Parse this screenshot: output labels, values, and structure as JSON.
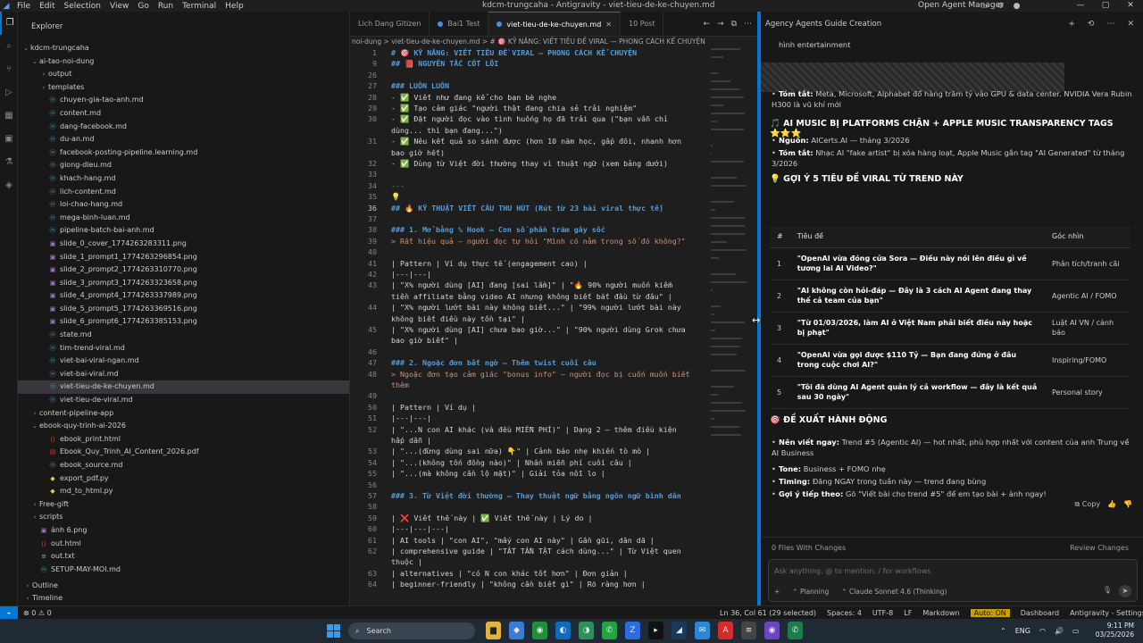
{
  "menubar": {
    "items": [
      "File",
      "Edit",
      "Selection",
      "View",
      "Go",
      "Run",
      "Terminal",
      "Help"
    ],
    "window_title": "kdcm-trungcaha - Antigravity - viet-tieu-de-ke-chuyen.md",
    "agent_manager": "Open Agent Manager"
  },
  "explorer": {
    "title": "Explorer",
    "root": "kdcm-trungcaha",
    "tree": [
      {
        "label": "ai-tao-noi-dung",
        "type": "folder-open",
        "indent": 1
      },
      {
        "label": "output",
        "type": "folder",
        "indent": 2
      },
      {
        "label": "templates",
        "type": "folder",
        "indent": 2
      },
      {
        "label": "chuyen-gia-tao-anh.md",
        "type": "md",
        "indent": 2
      },
      {
        "label": "content.md",
        "type": "md",
        "indent": 2
      },
      {
        "label": "dang-facebook.md",
        "type": "md",
        "indent": 2
      },
      {
        "label": "du-an.md",
        "type": "md",
        "indent": 2
      },
      {
        "label": "facebook-posting-pipeline.learning.md",
        "type": "md",
        "indent": 2
      },
      {
        "label": "giong-dieu.md",
        "type": "md",
        "indent": 2
      },
      {
        "label": "khach-hang.md",
        "type": "md",
        "indent": 2
      },
      {
        "label": "lich-content.md",
        "type": "md",
        "indent": 2
      },
      {
        "label": "loi-chao-hang.md",
        "type": "md",
        "indent": 2
      },
      {
        "label": "mega-binh-luan.md",
        "type": "md",
        "indent": 2
      },
      {
        "label": "pipeline-batch-bai-anh.md",
        "type": "md",
        "indent": 2
      },
      {
        "label": "slide_0_cover_1774263283311.png",
        "type": "png",
        "indent": 2
      },
      {
        "label": "slide_1_prompt1_1774263296854.png",
        "type": "png",
        "indent": 2
      },
      {
        "label": "slide_2_prompt2_1774263310770.png",
        "type": "png",
        "indent": 2
      },
      {
        "label": "slide_3_prompt3_1774263323658.png",
        "type": "png",
        "indent": 2
      },
      {
        "label": "slide_4_prompt4_1774263337989.png",
        "type": "png",
        "indent": 2
      },
      {
        "label": "slide_5_prompt5_1774263369516.png",
        "type": "png",
        "indent": 2
      },
      {
        "label": "slide_6_prompt6_1774263385153.png",
        "type": "png",
        "indent": 2
      },
      {
        "label": "state.md",
        "type": "md",
        "indent": 2
      },
      {
        "label": "tim-trend-viral.md",
        "type": "md",
        "indent": 2
      },
      {
        "label": "viet-bai-viral-ngan.md",
        "type": "md",
        "indent": 2
      },
      {
        "label": "viet-bai-viral.md",
        "type": "md",
        "indent": 2
      },
      {
        "label": "viet-tieu-de-ke-chuyen.md",
        "type": "md",
        "indent": 2,
        "selected": true
      },
      {
        "label": "viet-tieu-de-viral.md",
        "type": "md",
        "indent": 2
      },
      {
        "label": "content-pipeline-app",
        "type": "folder",
        "indent": 1
      },
      {
        "label": "ebook-quy-trinh-ai-2026",
        "type": "folder-open",
        "indent": 1
      },
      {
        "label": "ebook_print.html",
        "type": "html",
        "indent": 2
      },
      {
        "label": "Ebook_Quy_Trinh_AI_Content_2026.pdf",
        "type": "pdf",
        "indent": 2
      },
      {
        "label": "ebook_source.md",
        "type": "md",
        "indent": 2
      },
      {
        "label": "export_pdf.py",
        "type": "py",
        "indent": 2
      },
      {
        "label": "md_to_html.py",
        "type": "py",
        "indent": 2
      },
      {
        "label": "Free-gift",
        "type": "folder",
        "indent": 1
      },
      {
        "label": "scripts",
        "type": "folder",
        "indent": 1
      },
      {
        "label": "ảnh 6.png",
        "type": "png",
        "indent": 1
      },
      {
        "label": "out.html",
        "type": "html",
        "indent": 1
      },
      {
        "label": "out.txt",
        "type": "txt",
        "indent": 1
      },
      {
        "label": "SETUP-MAY-MOI.md",
        "type": "md",
        "indent": 1
      }
    ],
    "bottom": [
      "Outline",
      "Timeline"
    ]
  },
  "tabs": [
    {
      "label": "Lich Dang Gitizen",
      "active": false
    },
    {
      "label": "Bai1 Test",
      "active": false
    },
    {
      "label": "viet-tieu-de-ke-chuyen.md",
      "active": true
    },
    {
      "label": "10 Post",
      "active": false
    }
  ],
  "breadcrumb": "noi-dung > viet-tieu-de-ke-chuyen.md > # 🎯 KỸ NĂNG: VIẾT TIÊU ĐỀ VIRAL — PHONG CÁCH KỂ CHUYỆN",
  "code_lines": [
    {
      "n": "1",
      "t": "# 🎯 KỸ NĂNG: VIẾT TIÊU ĐỀ VIRAL — PHONG CÁCH KỂ CHUYỆN",
      "k": "h"
    },
    {
      "n": "9",
      "t": "## 📕 NGUYÊN TẮC CỐT LÕI",
      "k": "h"
    },
    {
      "n": "26",
      "t": "",
      "k": ""
    },
    {
      "n": "27",
      "t": "### LUÔN LUÔN",
      "k": "h"
    },
    {
      "n": "28",
      "t": "- ✅ Viết như đang kể cho bạn bè nghe",
      "k": ""
    },
    {
      "n": "29",
      "t": "- ✅ Tạo cảm giác \"người thật đang chia sẻ trải nghiệm\"",
      "k": ""
    },
    {
      "n": "30",
      "t": "- ✅ Đặt người đọc vào tình huống họ đã trải qua (\"bạn vẫn chỉ",
      "k": ""
    },
    {
      "n": "",
      "t": "dùng... thì bạn đang...\")",
      "k": ""
    },
    {
      "n": "31",
      "t": "- ✅ Nêu kết quả so sánh được (hơn 10 năm học, gấp đôi, nhanh hơn",
      "k": ""
    },
    {
      "n": "",
      "t": "bao giờ hết)",
      "k": ""
    },
    {
      "n": "32",
      "t": "- ✅ Dùng từ Việt đời thường thay vì thuật ngữ (xem bảng dưới)",
      "k": ""
    },
    {
      "n": "33",
      "t": "",
      "k": ""
    },
    {
      "n": "34",
      "t": "---",
      "k": "dash"
    },
    {
      "n": "35",
      "t": "💡",
      "k": ""
    },
    {
      "n": "36",
      "t": "## 🔥 KỸ THUẬT VIẾT CÂU THU HÚT (Rút từ 23 bài viral thực tế)",
      "k": "h",
      "cur": true
    },
    {
      "n": "37",
      "t": "",
      "k": ""
    },
    {
      "n": "38",
      "t": "### 1. Mở bằng % Hook — Con số phần trăm gây sốc",
      "k": "h"
    },
    {
      "n": "39",
      "t": "> Rất hiệu quả — người đọc tự hỏi \"Mình có nằm trong số đó không?\"",
      "k": "q"
    },
    {
      "n": "40",
      "t": "",
      "k": ""
    },
    {
      "n": "41",
      "t": "| Pattern | Ví dụ thực tế (engagement cao) |",
      "k": ""
    },
    {
      "n": "42",
      "t": "|---|---|",
      "k": ""
    },
    {
      "n": "43",
      "t": "| \"X% người dùng [AI] đang [sai lầm]\" | \"🔥 90% người muốn kiếm",
      "k": ""
    },
    {
      "n": "",
      "t": "tiền affiliate bằng video AI nhưng không biết bắt đầu từ đâu\" |",
      "k": ""
    },
    {
      "n": "44",
      "t": "| \"X% người lướt bài này không biết...\" | \"99% người lướt bài này",
      "k": ""
    },
    {
      "n": "",
      "t": "không biết điều này tồn tại\" |",
      "k": ""
    },
    {
      "n": "45",
      "t": "| \"X% người dùng [AI] chưa bao giờ...\" | \"90% người dùng Grok chưa",
      "k": ""
    },
    {
      "n": "",
      "t": "bao giờ biết\" |",
      "k": ""
    },
    {
      "n": "46",
      "t": "",
      "k": ""
    },
    {
      "n": "47",
      "t": "### 2. Ngoặc đơn bất ngờ — Thêm twist cuối câu",
      "k": "h"
    },
    {
      "n": "48",
      "t": "> Ngoặc đơn tạo cảm giác \"bonus info\" — người đọc bị cuốn muốn biết",
      "k": "q"
    },
    {
      "n": "",
      "t": "thêm",
      "k": "q"
    },
    {
      "n": "49",
      "t": "",
      "k": ""
    },
    {
      "n": "50",
      "t": "| Pattern | Ví dụ |",
      "k": ""
    },
    {
      "n": "51",
      "t": "|---|---|",
      "k": ""
    },
    {
      "n": "52",
      "t": "| \"...N con AI khác (và đều MIỄN PHÍ)\" | Dạng 2 — thêm điều kiện",
      "k": ""
    },
    {
      "n": "",
      "t": "hấp dẫn |",
      "k": ""
    },
    {
      "n": "53",
      "t": "| \"...(đừng dùng sai nữa) 👇\" | Cảnh báo nhẹ khiến tò mò |",
      "k": ""
    },
    {
      "n": "54",
      "t": "| \"...(không tốn đồng nào)\" | Nhấn miễn phí cuối câu |",
      "k": ""
    },
    {
      "n": "55",
      "t": "| \"...(mà không cần lộ mặt)\" | Giải tỏa nỗi lo |",
      "k": ""
    },
    {
      "n": "56",
      "t": "",
      "k": ""
    },
    {
      "n": "57",
      "t": "### 3. Từ Việt đời thường — Thay thuật ngữ bằng ngôn ngữ bình dân",
      "k": "h"
    },
    {
      "n": "58",
      "t": "",
      "k": ""
    },
    {
      "n": "59",
      "t": "| ❌ Viết thế này | ✅ Viết thế này | Lý do |",
      "k": ""
    },
    {
      "n": "60",
      "t": "|---|---|---|",
      "k": ""
    },
    {
      "n": "61",
      "t": "| AI tools | \"con AI\", \"mấy con AI này\" | Gần gũi, dân dã |",
      "k": ""
    },
    {
      "n": "62",
      "t": "| comprehensive guide | \"TẤT TẦN TẬT cách dùng...\" | Từ Việt quen",
      "k": ""
    },
    {
      "n": "",
      "t": "thuộc |",
      "k": ""
    },
    {
      "n": "63",
      "t": "| alternatives | \"có N con khác tốt hơn\" | Đơn giản |",
      "k": ""
    },
    {
      "n": "64",
      "t": "| beginner-friendly | \"không cần biết gì\" | Rõ ràng hơn |",
      "k": ""
    }
  ],
  "agent": {
    "title": "Agency Agents Guide Creation",
    "top_lines": [
      {
        "kind": "cont",
        "text": "hình entertainment"
      },
      {
        "kind": "kv",
        "key": "Tóm tắt:",
        "val": "Meta, Microsoft, Alphabet đổ hàng trăm tỷ vào GPU & data center. NVIDIA Vera Rubin H300 là vũ khí mới"
      }
    ],
    "music_heading": "AI MUSIC BỊ PLATFORMS CHẶN + APPLE MUSIC TRANSPARENCY TAGS ⭐⭐⭐",
    "music_lines": [
      {
        "key": "Nguồn:",
        "val": "AICerts.AI — tháng 3/2026"
      },
      {
        "key": "Tóm tắt:",
        "val": "Nhạc AI \"fake artist\" bị xóa hàng loạt, Apple Music gắn tag \"AI Generated\" từ tháng 3/2026"
      }
    ],
    "suggest_heading": "GỢI Ý 5 TIÊU ĐỀ VIRAL TỪ TREND NÀY",
    "table": {
      "headers": [
        "#",
        "Tiêu đề",
        "Góc nhìn"
      ],
      "rows": [
        {
          "n": "1",
          "title": "\"OpenAI vừa đóng cửa Sora — Điều này nói lên điều gì về tương lai AI Video?\"",
          "angle": "Phân tích/tranh cãi"
        },
        {
          "n": "2",
          "title": "\"AI không còn hỏi-đáp — Đây là 3 cách AI Agent đang thay thế cả team của bạn\"",
          "angle": "Agentic AI / FOMO"
        },
        {
          "n": "3",
          "title": "\"Từ 01/03/2026, làm AI ở Việt Nam phải biết điều này hoặc bị phạt\"",
          "angle": "Luật AI VN / cảnh báo"
        },
        {
          "n": "4",
          "title": "\"OpenAI vừa gọi được $110 Tỷ — Bạn đang đứng ở đâu trong cuộc chơi AI?\"",
          "angle": "Inspiring/FOMO"
        },
        {
          "n": "5",
          "title": "\"Tôi đã dùng AI Agent quản lý cả workflow — đây là kết quả sau 30 ngày\"",
          "angle": "Personal story"
        }
      ]
    },
    "action_heading": "ĐỀ XUẤT HÀNH ĐỘNG",
    "actions": [
      {
        "key": "Nên viết ngay:",
        "val": "Trend #5 (Agentic AI) — hot nhất, phù hợp nhất với content của anh Trung về AI Business"
      },
      {
        "key": "Tone:",
        "val": "Business + FOMO nhẹ"
      },
      {
        "key": "Timing:",
        "val": "Đăng NGAY trong tuần này — trend đang bùng"
      },
      {
        "key": "Gợi ý tiếp theo:",
        "val": "Gõ \"Viết bài cho trend #5\" để em tạo bài + ảnh ngay!"
      }
    ],
    "copy_label": "Copy",
    "files_changed": "0 Files With Changes",
    "review_label": "Review Changes",
    "input_placeholder": "Ask anything, @ to mention, / for workflows",
    "mode_label": "Planning",
    "model_label": "Claude Sonnet 4.6 (Thinking)"
  },
  "statusbar": {
    "problems": "⊗ 0  ⚠ 0",
    "position": "Ln 36, Col 61 (29 selected)",
    "spaces": "Spaces: 4",
    "encoding": "UTF-8",
    "eol": "LF",
    "language": "Markdown",
    "auto": "Auto: ON",
    "dashboard": "Dashboard",
    "settings": "Antigravity - Settings"
  },
  "taskbar": {
    "search": "Search",
    "lang": "ENG",
    "time": "9:11 PM",
    "date": "03/25/2026"
  }
}
